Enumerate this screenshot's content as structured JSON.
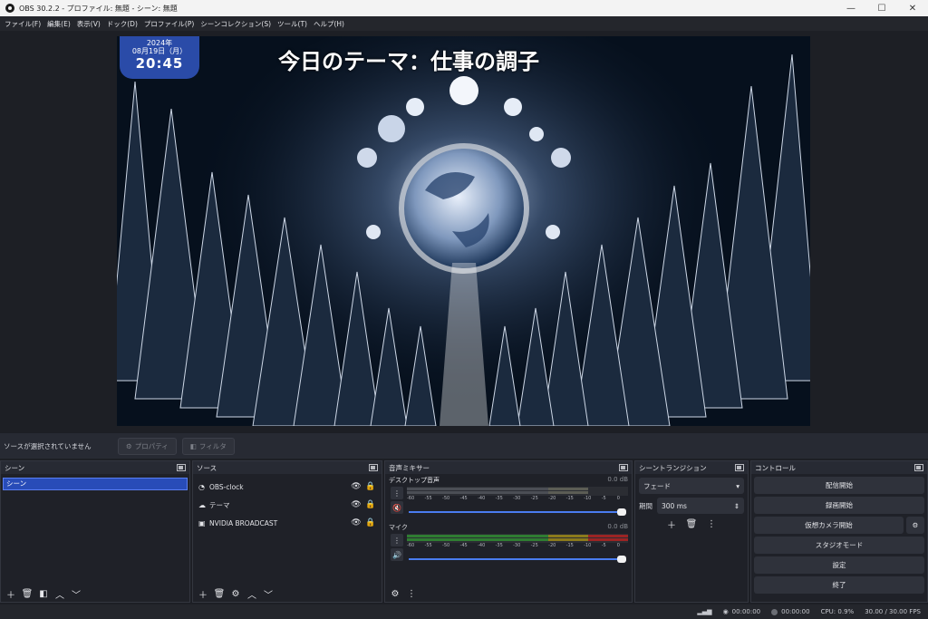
{
  "window": {
    "title": "OBS 30.2.2 - プロファイル: 無題 - シーン: 無題",
    "minimize": "—",
    "maximize": "☐",
    "close": "✕"
  },
  "menu": [
    "ファイル(F)",
    "編集(E)",
    "表示(V)",
    "ドック(D)",
    "プロファイル(P)",
    "シーンコレクション(S)",
    "ツール(T)",
    "ヘルプ(H)"
  ],
  "preview": {
    "clock": {
      "year": "2024年",
      "date": "08月19日（月）",
      "time": "20:45"
    },
    "theme_text": "今日のテーマ：仕事の調子"
  },
  "context": {
    "no_source": "ソースが選択されていません",
    "properties": "プロパティ",
    "filters": "フィルタ"
  },
  "scenes": {
    "title": "シーン",
    "items": [
      "シーン"
    ]
  },
  "sources": {
    "title": "ソース",
    "items": [
      {
        "icon": "◔",
        "label": "OBS-clock"
      },
      {
        "icon": "☁",
        "label": "テーマ"
      },
      {
        "icon": "▣",
        "label": "NVIDIA BROADCAST"
      }
    ]
  },
  "mixer": {
    "title": "音声ミキサー",
    "channels": [
      {
        "name": "デスクトップ音声",
        "db": "0.0 dB",
        "muted": true
      },
      {
        "name": "マイク",
        "db": "0.0 dB",
        "muted": false
      }
    ],
    "ticks": [
      "-60",
      "-55",
      "-50",
      "-45",
      "-40",
      "-35",
      "-30",
      "-25",
      "-20",
      "-15",
      "-10",
      "-5",
      "0"
    ]
  },
  "transitions": {
    "title": "シーントランジション",
    "selected": "フェード",
    "duration_label": "期間",
    "duration": "300 ms"
  },
  "controls": {
    "title": "コントロール",
    "start_stream": "配信開始",
    "start_record": "録画開始",
    "virtual_camera": "仮想カメラ開始",
    "studio_mode": "スタジオモード",
    "settings": "設定",
    "exit": "終了"
  },
  "status": {
    "stream_time": "00:00:00",
    "record_time": "00:00:00",
    "cpu": "CPU: 0.9%",
    "fps": "30.00 / 30.00 FPS"
  },
  "colors": {
    "accent": "#284cb8",
    "bg": "#1d1f25",
    "meter_green": "#2f7d32",
    "meter_yellow": "#8b7a1c",
    "meter_red": "#9b2424"
  }
}
